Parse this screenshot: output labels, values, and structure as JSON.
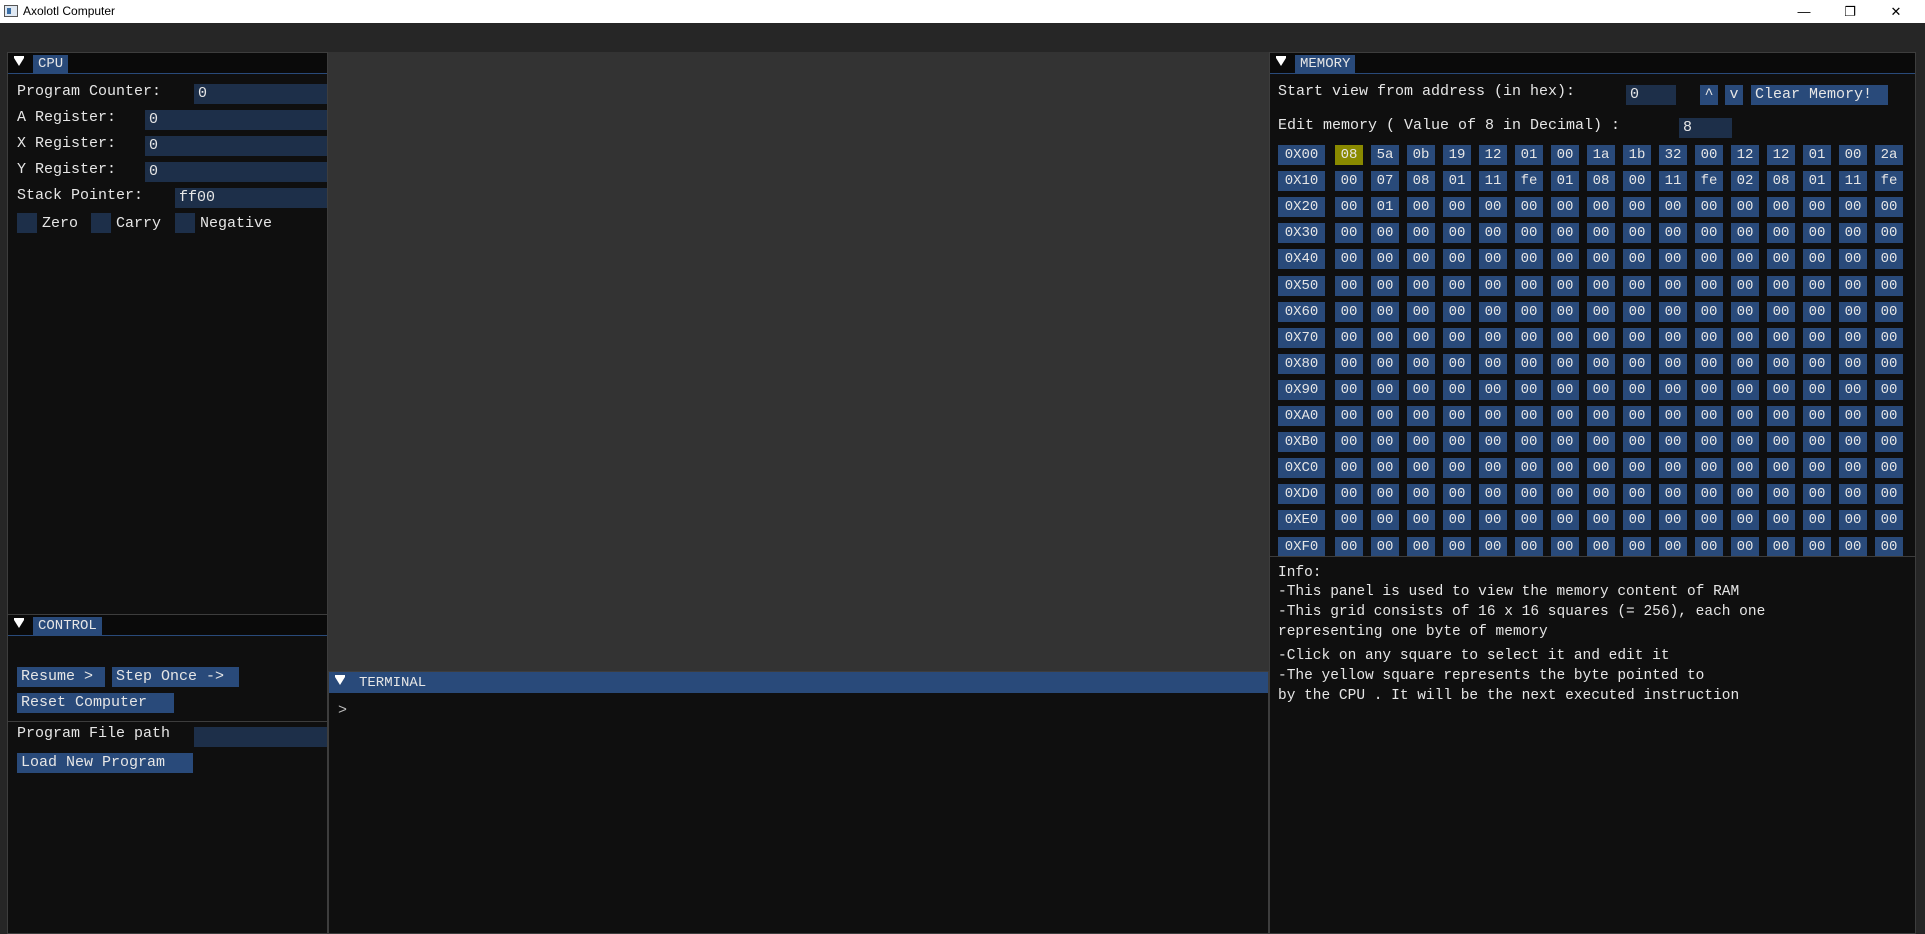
{
  "window": {
    "title": "Axolotl Computer",
    "min_glyph": "—",
    "max_glyph": "❐",
    "close_glyph": "✕"
  },
  "cpu": {
    "title": "CPU",
    "program_counter": {
      "label": "Program Counter:",
      "value": "0"
    },
    "a_register": {
      "label": "A Register:",
      "value": "0"
    },
    "x_register": {
      "label": "X Register:",
      "value": "0"
    },
    "y_register": {
      "label": "Y Register:",
      "value": "0"
    },
    "stack_pointer": {
      "label": "Stack Pointer:",
      "value": "ff00"
    },
    "flags": [
      {
        "label": "Zero",
        "checked": false
      },
      {
        "label": "Carry",
        "checked": false
      },
      {
        "label": "Negative",
        "checked": false
      }
    ]
  },
  "control": {
    "title": "CONTROL",
    "resume_label": "Resume >",
    "step_label": "Step Once ->",
    "reset_label": "Reset Computer",
    "file_path_label": "Program File path",
    "file_path_value": "",
    "load_label": "Load New Program"
  },
  "terminal": {
    "title": "TERMINAL",
    "prompt": ">"
  },
  "memory": {
    "title": "MEMORY",
    "start_label": "Start view from address (in hex):",
    "start_value": "0",
    "up_label": "^",
    "down_label": "v",
    "clear_label": "Clear Memory!",
    "edit_label": "Edit memory ( Value of 8 in Decimal) :",
    "edit_value": "8",
    "current_row": 0,
    "current_col": 0,
    "highlight_color": "#8a8a00",
    "rows": [
      {
        "addr": "0X00",
        "bytes": [
          "08",
          "5a",
          "0b",
          "19",
          "12",
          "01",
          "00",
          "1a",
          "1b",
          "32",
          "00",
          "12",
          "12",
          "01",
          "00",
          "2a"
        ]
      },
      {
        "addr": "0X10",
        "bytes": [
          "00",
          "07",
          "08",
          "01",
          "11",
          "fe",
          "01",
          "08",
          "00",
          "11",
          "fe",
          "02",
          "08",
          "01",
          "11",
          "fe"
        ]
      },
      {
        "addr": "0X20",
        "bytes": [
          "00",
          "01",
          "00",
          "00",
          "00",
          "00",
          "00",
          "00",
          "00",
          "00",
          "00",
          "00",
          "00",
          "00",
          "00",
          "00"
        ]
      },
      {
        "addr": "0X30",
        "bytes": [
          "00",
          "00",
          "00",
          "00",
          "00",
          "00",
          "00",
          "00",
          "00",
          "00",
          "00",
          "00",
          "00",
          "00",
          "00",
          "00"
        ]
      },
      {
        "addr": "0X40",
        "bytes": [
          "00",
          "00",
          "00",
          "00",
          "00",
          "00",
          "00",
          "00",
          "00",
          "00",
          "00",
          "00",
          "00",
          "00",
          "00",
          "00"
        ]
      },
      {
        "addr": "0X50",
        "bytes": [
          "00",
          "00",
          "00",
          "00",
          "00",
          "00",
          "00",
          "00",
          "00",
          "00",
          "00",
          "00",
          "00",
          "00",
          "00",
          "00"
        ]
      },
      {
        "addr": "0X60",
        "bytes": [
          "00",
          "00",
          "00",
          "00",
          "00",
          "00",
          "00",
          "00",
          "00",
          "00",
          "00",
          "00",
          "00",
          "00",
          "00",
          "00"
        ]
      },
      {
        "addr": "0X70",
        "bytes": [
          "00",
          "00",
          "00",
          "00",
          "00",
          "00",
          "00",
          "00",
          "00",
          "00",
          "00",
          "00",
          "00",
          "00",
          "00",
          "00"
        ]
      },
      {
        "addr": "0X80",
        "bytes": [
          "00",
          "00",
          "00",
          "00",
          "00",
          "00",
          "00",
          "00",
          "00",
          "00",
          "00",
          "00",
          "00",
          "00",
          "00",
          "00"
        ]
      },
      {
        "addr": "0X90",
        "bytes": [
          "00",
          "00",
          "00",
          "00",
          "00",
          "00",
          "00",
          "00",
          "00",
          "00",
          "00",
          "00",
          "00",
          "00",
          "00",
          "00"
        ]
      },
      {
        "addr": "0XA0",
        "bytes": [
          "00",
          "00",
          "00",
          "00",
          "00",
          "00",
          "00",
          "00",
          "00",
          "00",
          "00",
          "00",
          "00",
          "00",
          "00",
          "00"
        ]
      },
      {
        "addr": "0XB0",
        "bytes": [
          "00",
          "00",
          "00",
          "00",
          "00",
          "00",
          "00",
          "00",
          "00",
          "00",
          "00",
          "00",
          "00",
          "00",
          "00",
          "00"
        ]
      },
      {
        "addr": "0XC0",
        "bytes": [
          "00",
          "00",
          "00",
          "00",
          "00",
          "00",
          "00",
          "00",
          "00",
          "00",
          "00",
          "00",
          "00",
          "00",
          "00",
          "00"
        ]
      },
      {
        "addr": "0XD0",
        "bytes": [
          "00",
          "00",
          "00",
          "00",
          "00",
          "00",
          "00",
          "00",
          "00",
          "00",
          "00",
          "00",
          "00",
          "00",
          "00",
          "00"
        ]
      },
      {
        "addr": "0XE0",
        "bytes": [
          "00",
          "00",
          "00",
          "00",
          "00",
          "00",
          "00",
          "00",
          "00",
          "00",
          "00",
          "00",
          "00",
          "00",
          "00",
          "00"
        ]
      },
      {
        "addr": "0XF0",
        "bytes": [
          "00",
          "00",
          "00",
          "00",
          "00",
          "00",
          "00",
          "00",
          "00",
          "00",
          "00",
          "00",
          "00",
          "00",
          "00",
          "00"
        ]
      }
    ],
    "info": [
      "Info:",
      "-This panel is used to view the memory content of RAM",
      "-This grid consists of 16 x 16 squares (= 256), each one",
      "representing one byte of memory",
      "-Click on any square to select it and edit it",
      "-The yellow square represents the byte pointed to",
      "by the CPU . It will be the next executed instruction"
    ]
  }
}
